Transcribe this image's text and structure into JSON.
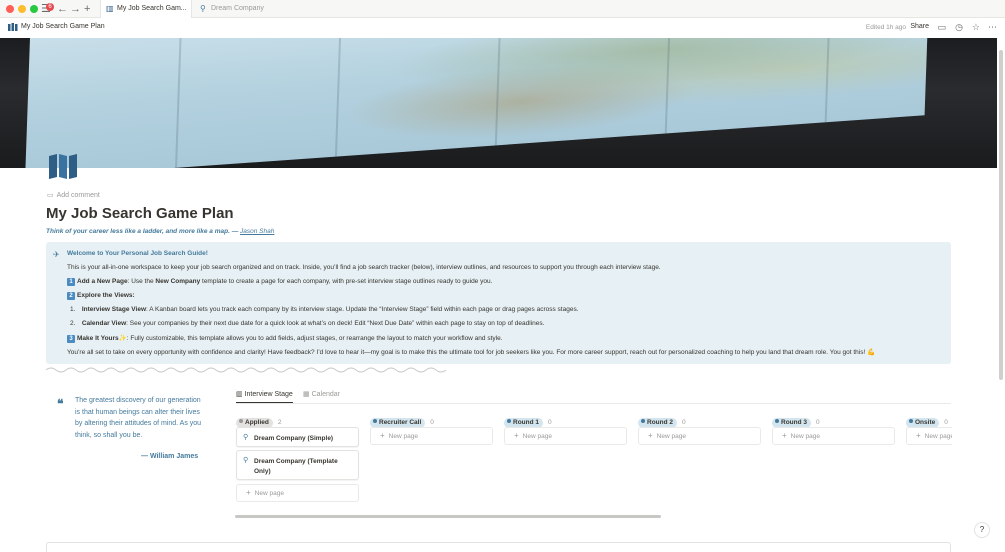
{
  "browser": {
    "badge_count": "6",
    "tabs": [
      {
        "label": "My Job Search Gam..."
      },
      {
        "label": "Dream Company"
      }
    ]
  },
  "header": {
    "title": "My Job Search Game Plan",
    "edited": "Edited 1h ago",
    "share": "Share"
  },
  "page": {
    "add_comment": "Add comment",
    "title": "My Job Search Game Plan",
    "quote": "Think of your career less like a ladder, and more like a map. — ",
    "quote_author": "Jason Shah"
  },
  "callout": {
    "title": "Welcome to Your Personal Job Search Guide!",
    "intro": "This is your all-in-one workspace to keep your job search organized and on track. Inside, you’ll find a job search tracker (below), interview outlines, and resources to support you through each interview stage.",
    "step1_label": "Add a New Page",
    "step1_mid": ": Use the ",
    "step1_bold": "New Company",
    "step1_rest": " template to create a page for each company, with pre-set interview stage outlines ready to guide you.",
    "step2_label": "Explore the Views:",
    "sub1_num": "1.",
    "sub1_label": "Interview Stage View",
    "sub1_rest": ": A Kanban board lets you track each company by its interview stage. Update the “Interview Stage” field within each page or drag pages across stages.",
    "sub2_num": "2.",
    "sub2_label": "Calendar View",
    "sub2_rest": ": See your companies by their next due date for a quick look at what’s on deck! Edit “Next Due Date” within each page to stay on top of deadlines.",
    "step3_label": "Make It Yours",
    "step3_emoji": "✨",
    "step3_rest": ": Fully customizable, this template allows you to add fields, adjust stages, or rearrange the layout to match your workflow and style.",
    "closing": "You’re all set to take on every opportunity with confidence and clarity! Have feedback? I’d love to hear it—my goal is to make this the ultimate tool for job seekers like you. For more career support, reach out for personalized coaching to help you land that dream role. You got this! 💪",
    "badges": {
      "one": "1",
      "two": "2",
      "three": "3"
    }
  },
  "quote_block": {
    "text": "The greatest discovery of our generation is that human beings can alter their lives by altering their attitudes of mind. As you think, so shall you be.",
    "author": "— William James"
  },
  "board": {
    "views": [
      {
        "label": "Interview Stage"
      },
      {
        "label": "Calendar"
      }
    ],
    "columns": [
      {
        "label": "Applied",
        "count": "2",
        "color": "#9b9a97",
        "bg": "#e3e2e0"
      },
      {
        "label": "Recruiter Call",
        "count": "0",
        "color": "#447a9c",
        "bg": "#d3e5ef"
      },
      {
        "label": "Round 1",
        "count": "0",
        "color": "#447a9c",
        "bg": "#d3e5ef"
      },
      {
        "label": "Round 2",
        "count": "0",
        "color": "#447a9c",
        "bg": "#d3e5ef"
      },
      {
        "label": "Round 3",
        "count": "0",
        "color": "#447a9c",
        "bg": "#d3e5ef"
      },
      {
        "label": "Onsite",
        "count": "0",
        "color": "#447a9c",
        "bg": "#d3e5ef"
      }
    ],
    "cards": [
      {
        "title": "Dream Company (Simple)"
      },
      {
        "title": "Dream Company (Template Only)"
      }
    ],
    "new_page": "New page"
  },
  "colors": {
    "accent": "#447a9c",
    "callout_bg": "#e7f0f4"
  }
}
